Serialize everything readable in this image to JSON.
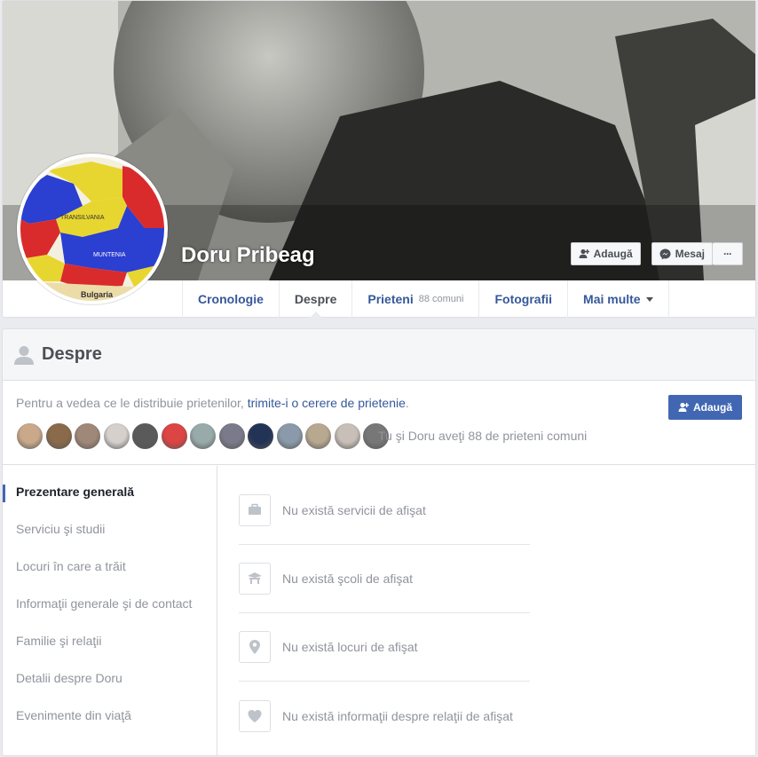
{
  "profile": {
    "name": "Doru Pribeag"
  },
  "cover_buttons": {
    "add_friend": "Adaugă",
    "message": "Mesaj",
    "more": "···"
  },
  "tabs": [
    {
      "label": "Cronologie"
    },
    {
      "label": "Despre",
      "active": true
    },
    {
      "label": "Prieteni",
      "count": "88 comuni"
    },
    {
      "label": "Fotografii"
    },
    {
      "label": "Mai multe"
    }
  ],
  "about": {
    "title": "Despre",
    "friend_request": {
      "prefix": "Pentru a vedea ce le distribuie prietenilor,",
      "link": "trimite-i o cerere de prietenie",
      "suffix": "."
    },
    "add_button": "Adaugă",
    "mutual_text": "Tu şi Doru aveţi 88 de prieteni comuni",
    "mutual_friend_colors": [
      "#c9a98a",
      "#8a6a4a",
      "#a08878",
      "#d5d0cc",
      "#5a5a5a",
      "#d44",
      "#9aa",
      "#7a7a8a",
      "#223355",
      "#8a9aaa",
      "#b8a890",
      "#c8c0b8",
      "#777"
    ],
    "nav": [
      {
        "label": "Prezentare generală",
        "active": true
      },
      {
        "label": "Serviciu şi studii"
      },
      {
        "label": "Locuri în care a trăit"
      },
      {
        "label": "Informaţii generale şi de contact"
      },
      {
        "label": "Familie şi relaţii"
      },
      {
        "label": "Detalii despre Doru"
      },
      {
        "label": "Evenimente din viaţă"
      }
    ],
    "empty_rows": [
      {
        "icon": "briefcase-icon",
        "text": "Nu există servicii de afişat"
      },
      {
        "icon": "school-icon",
        "text": "Nu există şcoli de afişat"
      },
      {
        "icon": "location-pin-icon",
        "text": "Nu există locuri de afişat"
      },
      {
        "icon": "heart-icon",
        "text": "Nu există informaţii despre relaţii de afişat"
      }
    ]
  },
  "avatar_map_labels": [
    "TRANSILVANIA",
    "MUNTENIA",
    "Bulgaria"
  ]
}
